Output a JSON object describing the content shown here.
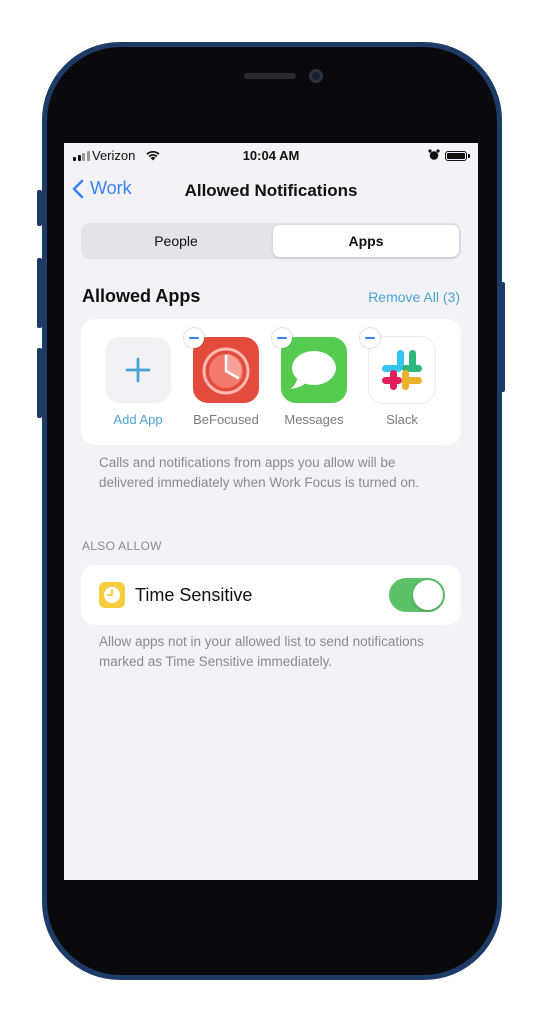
{
  "status_bar": {
    "carrier": "Verizon",
    "time": "10:04 AM"
  },
  "nav": {
    "back_label": "Work",
    "title": "Allowed Notifications"
  },
  "segmented": {
    "options": [
      "People",
      "Apps"
    ],
    "selected": "Apps"
  },
  "allowed_apps": {
    "title": "Allowed Apps",
    "remove_all_label": "Remove All (3)",
    "add_app_label": "Add App",
    "apps": [
      {
        "name": "BeFocused",
        "icon": "befocused-timer-icon",
        "color": "#e34b3c"
      },
      {
        "name": "Messages",
        "icon": "messages-bubble-icon",
        "color": "#55cc4f"
      },
      {
        "name": "Slack",
        "icon": "slack-logo-icon",
        "color": "#ffffff"
      }
    ],
    "note": "Calls and notifications from apps you allow will be delivered immediately when Work Focus is turned on."
  },
  "also_allow": {
    "header": "ALSO ALLOW",
    "time_sensitive": {
      "label": "Time Sensitive",
      "enabled": true,
      "icon": "clock-icon"
    },
    "note": "Allow apps not in your allowed list to send notifications marked as Time Sensitive immediately."
  },
  "colors": {
    "accent": "#3a82f7",
    "link": "#4aa3d6",
    "toggle_on": "#5cc168",
    "background": "#f2f2f7"
  }
}
